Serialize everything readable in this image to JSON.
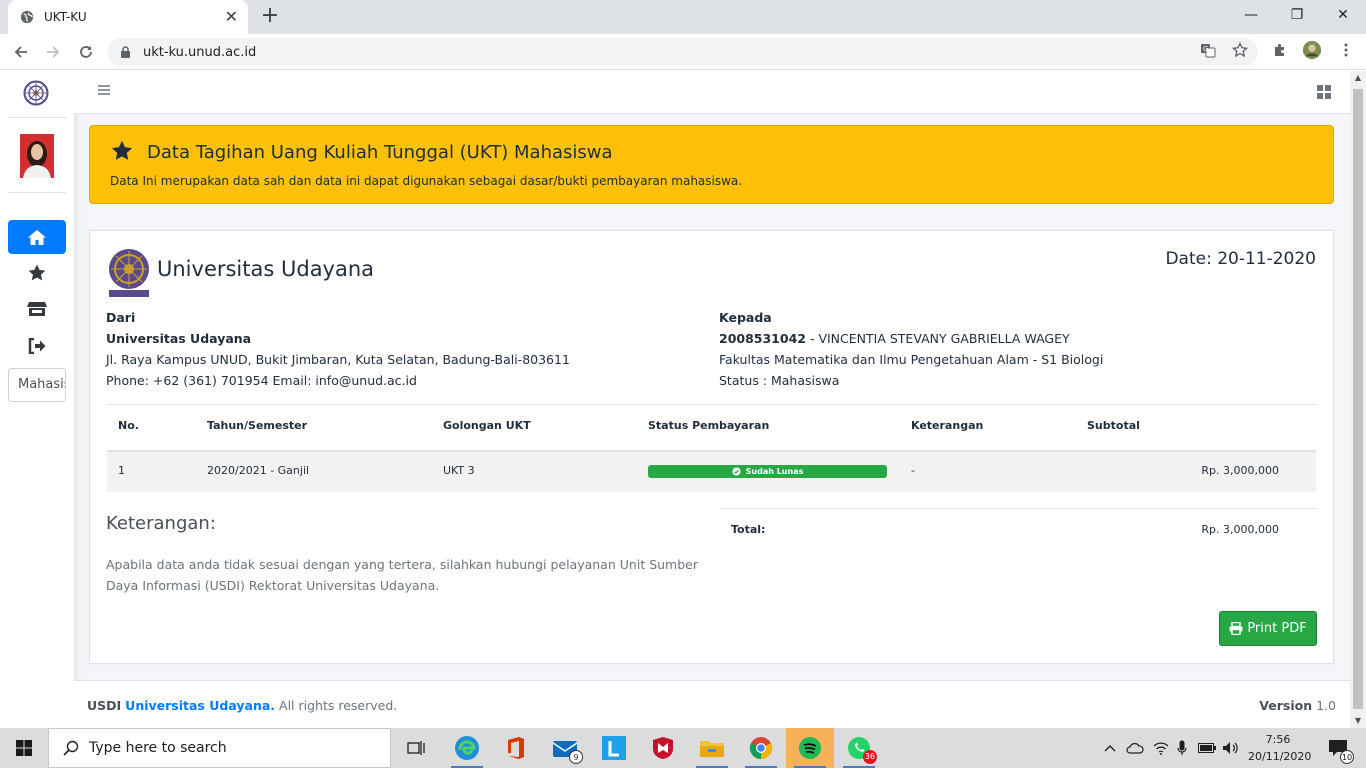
{
  "browser": {
    "tab_title": "UKT-KU",
    "tab_close": "✕",
    "new_tab": "+",
    "url": "ukt-ku.unud.ac.id",
    "win_min": "—",
    "win_restore": "❐",
    "win_close": "✕"
  },
  "sidebar": {
    "search_placeholder": "Mahasiswa",
    "active_color": "#007bff",
    "items": [
      {
        "icon": "home-icon",
        "active": true
      },
      {
        "icon": "star-icon",
        "active": false
      },
      {
        "icon": "store-icon",
        "active": false
      },
      {
        "icon": "sign-out-icon",
        "active": false
      }
    ]
  },
  "callout": {
    "title": "Data Tagihan Uang Kuliah Tunggal (UKT) Mahasiswa",
    "text": "Data Ini merupakan data sah dan data ini dapat digunakan sebagai dasar/bukti pembayaran mahasiswa.",
    "color": "#ffc107"
  },
  "invoice": {
    "brand": "Universitas Udayana",
    "date": "Date: 20-11-2020",
    "from": {
      "label": "Dari",
      "name": "Universitas Udayana",
      "address": "Jl. Raya Kampus UNUD, Bukit Jimbaran, Kuta Selatan, Badung-Bali-803611",
      "contact": "Phone: +62 (361) 701954 Email: info@unud.ac.id"
    },
    "to": {
      "label": "Kepada",
      "nim": "2008531042",
      "name": " - VINCENTIA STEVANY GABRIELLA WAGEY",
      "faculty": "Fakultas Matematika dan Ilmu Pengetahuan Alam - S1 Biologi",
      "status": "Status : Mahasiswa"
    },
    "columns": [
      "No.",
      "Tahun/Semester",
      "Golongan UKT",
      "Status Pembayaran",
      "Keterangan",
      "Subtotal"
    ],
    "rows": [
      {
        "no": "1",
        "period": "2020/2021 - Ganjil",
        "group": "UKT 3",
        "status": "Sudah Lunas",
        "note": "-",
        "subtotal": "Rp. 3,000,000"
      }
    ],
    "status_color": "#28a745",
    "notes_title": "Keterangan:",
    "notes_text": "Apabila data anda tidak sesuai dengan yang tertera, silahkan hubungi pelayanan Unit Sumber Daya Informasi (USDI) Rektorat Universitas Udayana.",
    "total_label": "Total:",
    "total_value": "Rp. 3,000,000",
    "print_label": "Print PDF"
  },
  "footer": {
    "org": "USDI",
    "link": "Universitas Udayana.",
    "rights": "All rights reserved.",
    "version_label": "Version",
    "version": "1.0"
  },
  "taskbar": {
    "search_placeholder": "Type here to search",
    "mail_badge": "9",
    "whatsapp_badge": "36",
    "time": "7:56",
    "date": "20/11/2020",
    "notif_badge": "10"
  }
}
